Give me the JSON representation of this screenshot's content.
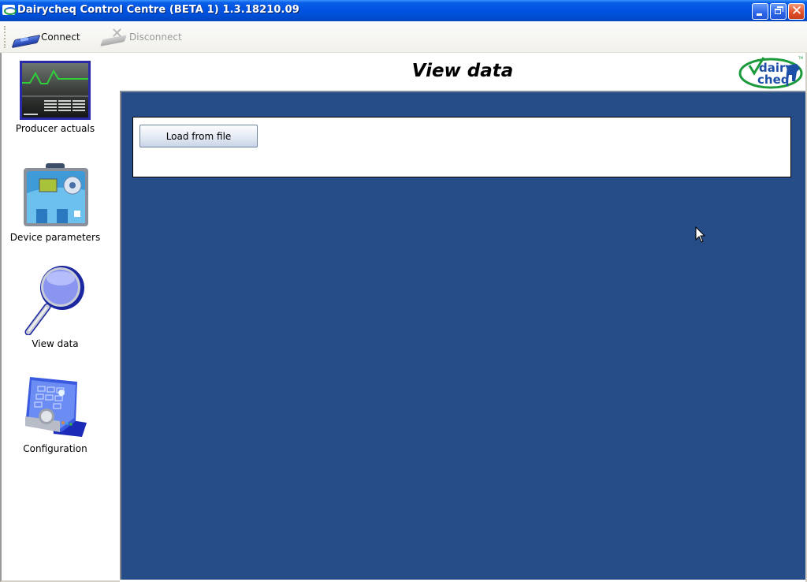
{
  "window": {
    "title": "Dairycheq Control Centre (BETA 1) 1.3.18210.09",
    "controls": {
      "minimize": "minimize",
      "restore": "restore",
      "close": "close"
    }
  },
  "toolbar": {
    "items": [
      {
        "label": "Connect",
        "icon": "connect-icon",
        "enabled": true
      },
      {
        "label": "Disconnect",
        "icon": "disconnect-icon",
        "enabled": false
      }
    ]
  },
  "sidebar": {
    "items": [
      {
        "label": "Producer actuals",
        "icon": "producer-actuals-icon"
      },
      {
        "label": "Device parameters",
        "icon": "device-parameters-icon"
      },
      {
        "label": "View data",
        "icon": "magnifier-icon",
        "active": true
      },
      {
        "label": "Configuration",
        "icon": "configuration-icon"
      }
    ]
  },
  "header": {
    "title": "View data",
    "logo": {
      "line1": "dairy",
      "line2": "cheq",
      "trademark": "TM"
    }
  },
  "main": {
    "load_button_label": "Load from file"
  },
  "colors": {
    "content_bg": "#264d87",
    "titlebar": "#0053e1",
    "logo_green": "#1a9a3a",
    "logo_blue": "#1d4fa8"
  }
}
